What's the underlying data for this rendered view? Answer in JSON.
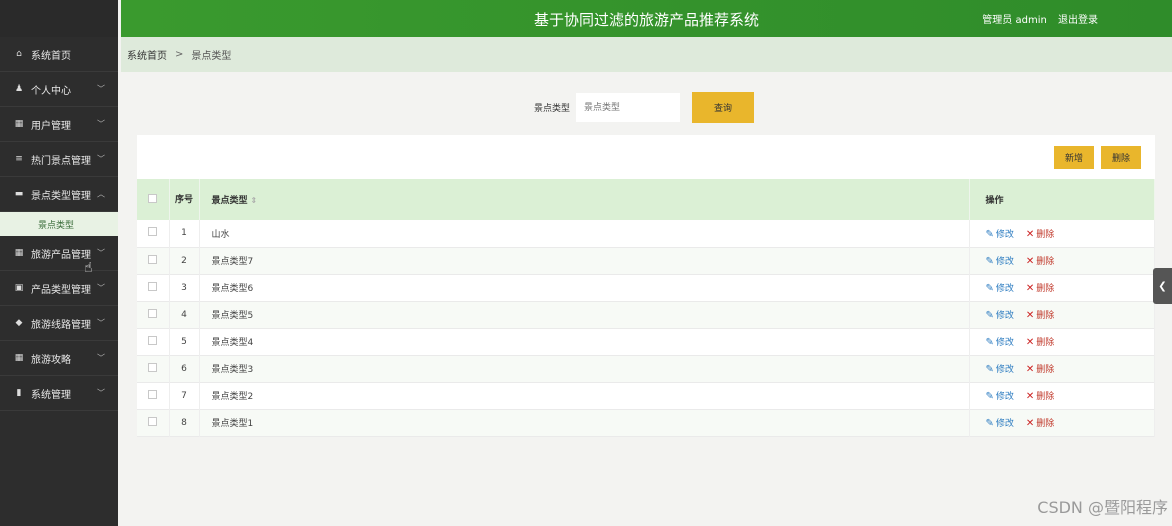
{
  "header": {
    "title": "基于协同过滤的旅游产品推荐系统",
    "user_label": "管理员 admin",
    "logout_label": "退出登录"
  },
  "sidebar": {
    "items": [
      {
        "icon": "home-icon",
        "glyph": "⌂",
        "label": "系统首页",
        "chevron": false
      },
      {
        "icon": "user-icon",
        "glyph": "♟",
        "label": "个人中心",
        "chevron": true
      },
      {
        "icon": "grid-icon",
        "glyph": "▦",
        "label": "用户管理",
        "chevron": true
      },
      {
        "icon": "list-icon",
        "glyph": "≡",
        "label": "热门景点管理",
        "chevron": true
      },
      {
        "icon": "tag-icon",
        "glyph": "▬",
        "label": "景点类型管理",
        "chevron": true,
        "expanded": true
      }
    ],
    "sub_item": "景点类型",
    "items2": [
      {
        "icon": "grid-icon",
        "glyph": "▦",
        "label": "旅游产品管理"
      },
      {
        "icon": "clipboard-icon",
        "glyph": "▣",
        "label": "产品类型管理"
      },
      {
        "icon": "thumb-icon",
        "glyph": "◆",
        "label": "旅游线路管理"
      },
      {
        "icon": "grid-icon",
        "glyph": "▦",
        "label": "旅游攻略"
      },
      {
        "icon": "book-icon",
        "glyph": "▮",
        "label": "系统管理"
      }
    ]
  },
  "breadcrumb": {
    "home": "系统首页",
    "separator": ">",
    "current": "景点类型"
  },
  "search": {
    "label": "景点类型",
    "placeholder": "景点类型",
    "button": "查询"
  },
  "toolbar": {
    "add_label": "新增",
    "delete_label": "删除"
  },
  "table": {
    "headers": {
      "index": "序号",
      "type": "景点类型",
      "sort_icon": "sort-icon",
      "actions": "操作"
    },
    "rows": [
      {
        "index": "1",
        "type": "山水"
      },
      {
        "index": "2",
        "type": "景点类型7"
      },
      {
        "index": "3",
        "type": "景点类型6"
      },
      {
        "index": "4",
        "type": "景点类型5"
      },
      {
        "index": "5",
        "type": "景点类型4"
      },
      {
        "index": "6",
        "type": "景点类型3"
      },
      {
        "index": "7",
        "type": "景点类型2"
      },
      {
        "index": "8",
        "type": "景点类型1"
      }
    ],
    "edit_label": "修改",
    "delete_label": "删除"
  },
  "watermark": "CSDN @暨阳程序",
  "colors": {
    "header_green": "#3a9a2e",
    "sidebar_dark": "#2d2d2d",
    "button_yellow": "#e9b62c",
    "table_header": "#dbf0d5"
  }
}
